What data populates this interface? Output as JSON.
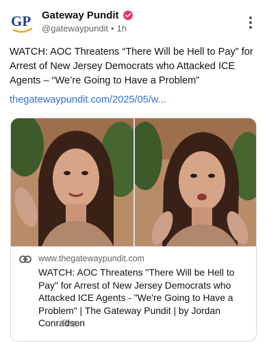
{
  "account": {
    "avatar_text": "GP",
    "display_name": "Gateway Pundit",
    "handle": "@gatewaypundit",
    "separator": "•",
    "time_ago": "1h",
    "brand_color": "#1b3f91",
    "verified_color": "#e8336d"
  },
  "post": {
    "text": "WATCH: AOC Threatens “There Will be Hell to Pay” for Arrest of New Jersey Democrats who Attacked ICE Agents – “We’re Going to Have a Problem”",
    "link_text": "thegatewaypundit.com/2025/05/w..."
  },
  "card": {
    "domain": "www.thegatewaypundit.com",
    "title": "WATCH: AOC Threatens \"There Will be Hell to Pay\" for Arrest of New Jersey Democrats who Attacked ICE Agents - \"We're Going to Have a Problem\" | The Gateway Pundit | by Jordan Conradson",
    "footer_label": "Rep."
  },
  "icons": {
    "verified": "verified-badge-icon",
    "more": "more-vertical-icon",
    "link": "link-icon"
  }
}
